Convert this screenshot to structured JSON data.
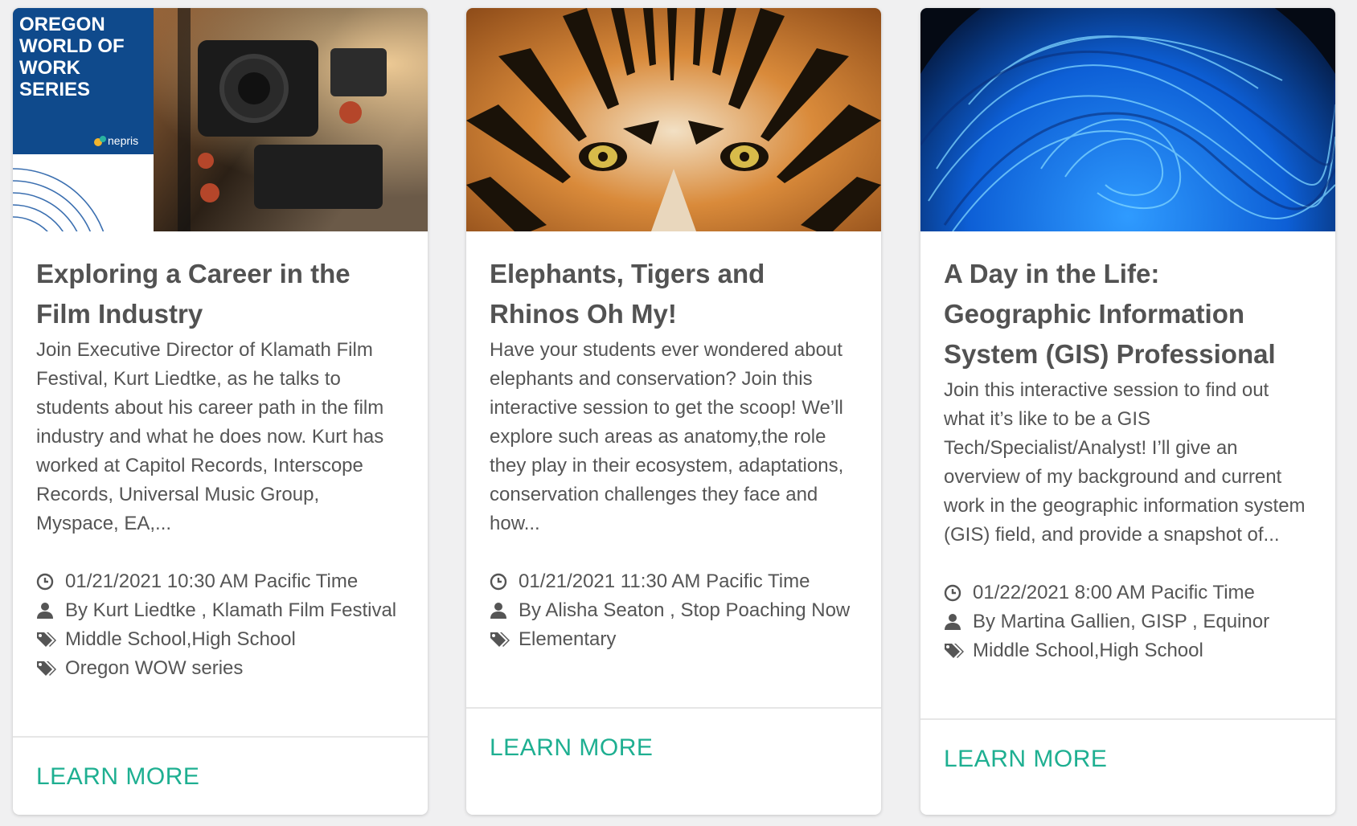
{
  "cards": [
    {
      "title": "Exploring a Career in the Film Industry",
      "description": "Join Executive Director of Klamath Film Festival, Kurt Liedtke, as he talks to students about his career path in the film industry and what he does now. Kurt has worked at Capitol Records, Interscope Records, Universal Music Group, Myspace, EA,...",
      "datetime": "01/21/2021 10:30 AM Pacific Time",
      "speaker": "By Kurt Liedtke , Klamath Film Festival",
      "grades": "Middle School,High School",
      "series": "Oregon WOW series",
      "cta": "LEARN MORE",
      "image": {
        "banner_title": "OREGON WORLD OF WORK SERIES",
        "banner_brand": "nepris",
        "banner_color": "#0f4a8c"
      }
    },
    {
      "title": "Elephants, Tigers and Rhinos Oh My!",
      "description": "Have your students ever wondered about elephants and conservation? Join this interactive session to get the scoop! We’ll explore such areas as anatomy,the role they play in their ecosystem, adaptations, conservation challenges they face and how...",
      "datetime": "01/21/2021 11:30 AM Pacific Time",
      "speaker": "By Alisha Seaton , Stop Poaching Now",
      "grades": "Elementary",
      "cta": "LEARN MORE"
    },
    {
      "title": "A Day in the Life: Geographic Information System (GIS) Professional",
      "description": "Join this interactive session to find out what it’s like to be a GIS Tech/Specialist/Analyst! I’ll give an overview of my background and current work in the geographic information system (GIS) field, and provide a snapshot of...",
      "datetime": "01/22/2021 8:00 AM Pacific Time",
      "speaker": "By Martina Gallien, GISP , Equinor",
      "grades": "Middle School,High School",
      "cta": "LEARN MORE"
    }
  ],
  "colors": {
    "accent": "#1eaf91",
    "title": "#525252",
    "text": "#555555"
  },
  "icons": {
    "datetime": "clock-icon",
    "speaker": "user-icon",
    "grades": "tags-icon",
    "series": "tags-icon"
  }
}
